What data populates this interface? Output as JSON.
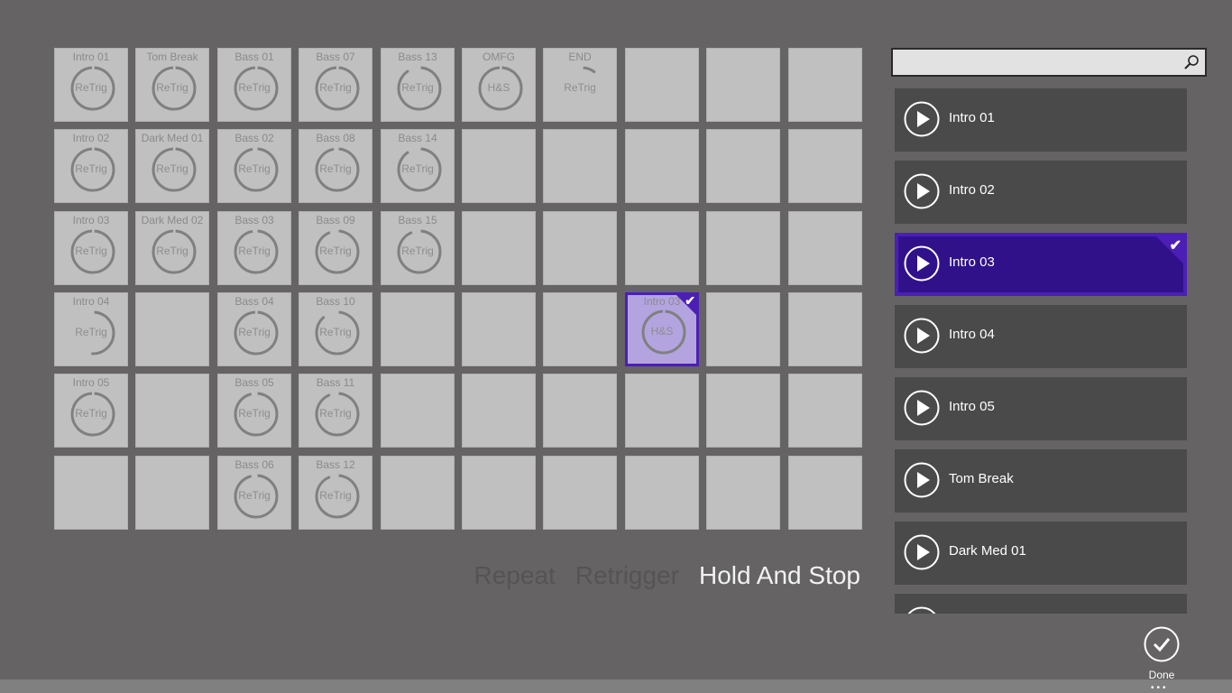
{
  "pads": {
    "columns": 10,
    "rows": 6,
    "cells": [
      {
        "row": 0,
        "col": 0,
        "title": "Intro 01",
        "mode": "ReTrig",
        "progress": 0.98
      },
      {
        "row": 0,
        "col": 1,
        "title": "Tom Break",
        "mode": "ReTrig",
        "progress": 0.98
      },
      {
        "row": 0,
        "col": 2,
        "title": "Bass 01",
        "mode": "ReTrig",
        "progress": 0.98
      },
      {
        "row": 0,
        "col": 3,
        "title": "Bass 07",
        "mode": "ReTrig",
        "progress": 0.98
      },
      {
        "row": 0,
        "col": 4,
        "title": "Bass 13",
        "mode": "ReTrig",
        "progress": 0.9
      },
      {
        "row": 0,
        "col": 5,
        "title": "OMFG",
        "mode": "H&S",
        "progress": 0.98
      },
      {
        "row": 0,
        "col": 6,
        "title": "END",
        "mode": "ReTrig",
        "progress": 0.1
      },
      {
        "row": 1,
        "col": 0,
        "title": "Intro 02",
        "mode": "ReTrig",
        "progress": 0.98
      },
      {
        "row": 1,
        "col": 1,
        "title": "Dark Med 01",
        "mode": "ReTrig",
        "progress": 0.98
      },
      {
        "row": 1,
        "col": 2,
        "title": "Bass 02",
        "mode": "ReTrig",
        "progress": 0.96
      },
      {
        "row": 1,
        "col": 3,
        "title": "Bass 08",
        "mode": "ReTrig",
        "progress": 0.96
      },
      {
        "row": 1,
        "col": 4,
        "title": "Bass 14",
        "mode": "ReTrig",
        "progress": 0.9
      },
      {
        "row": 2,
        "col": 0,
        "title": "Intro 03",
        "mode": "ReTrig",
        "progress": 0.98
      },
      {
        "row": 2,
        "col": 1,
        "title": "Dark Med 02",
        "mode": "ReTrig",
        "progress": 0.98
      },
      {
        "row": 2,
        "col": 2,
        "title": "Bass 03",
        "mode": "ReTrig",
        "progress": 0.96
      },
      {
        "row": 2,
        "col": 3,
        "title": "Bass 09",
        "mode": "ReTrig",
        "progress": 0.93
      },
      {
        "row": 2,
        "col": 4,
        "title": "Bass 15",
        "mode": "ReTrig",
        "progress": 0.93
      },
      {
        "row": 3,
        "col": 0,
        "title": "Intro 04",
        "mode": "ReTrig",
        "progress": 0.5
      },
      {
        "row": 3,
        "col": 2,
        "title": "Bass 04",
        "mode": "ReTrig",
        "progress": 0.98
      },
      {
        "row": 3,
        "col": 3,
        "title": "Bass 10",
        "mode": "ReTrig",
        "progress": 0.88
      },
      {
        "row": 3,
        "col": 7,
        "title": "Intro 03",
        "mode": "H&S",
        "progress": 0.98,
        "selected": true
      },
      {
        "row": 4,
        "col": 0,
        "title": "Intro 05",
        "mode": "ReTrig",
        "progress": 0.98
      },
      {
        "row": 4,
        "col": 2,
        "title": "Bass 05",
        "mode": "ReTrig",
        "progress": 0.95
      },
      {
        "row": 4,
        "col": 3,
        "title": "Bass 11",
        "mode": "ReTrig",
        "progress": 0.93
      },
      {
        "row": 5,
        "col": 2,
        "title": "Bass 06",
        "mode": "ReTrig",
        "progress": 0.95
      },
      {
        "row": 5,
        "col": 3,
        "title": "Bass 12",
        "mode": "ReTrig",
        "progress": 0.93
      }
    ]
  },
  "modes": {
    "repeat": "Repeat",
    "retrigger": "Retrigger",
    "hold_and_stop": "Hold And Stop",
    "active": "hold_and_stop"
  },
  "search": {
    "value": "",
    "placeholder": ""
  },
  "samples": [
    {
      "label": "Intro 01"
    },
    {
      "label": "Intro 02"
    },
    {
      "label": "Intro 03",
      "selected": true
    },
    {
      "label": "Intro 04"
    },
    {
      "label": "Intro 05"
    },
    {
      "label": "Tom Break"
    },
    {
      "label": "Dark Med 01"
    },
    {
      "label": ""
    }
  ],
  "done": {
    "label": "Done"
  },
  "appbar": {
    "more": "•••"
  },
  "colors": {
    "accent": "#4b1fb6",
    "selected_fill": "#30118a",
    "pad": "#c0c0c0",
    "ring": "#808080"
  }
}
